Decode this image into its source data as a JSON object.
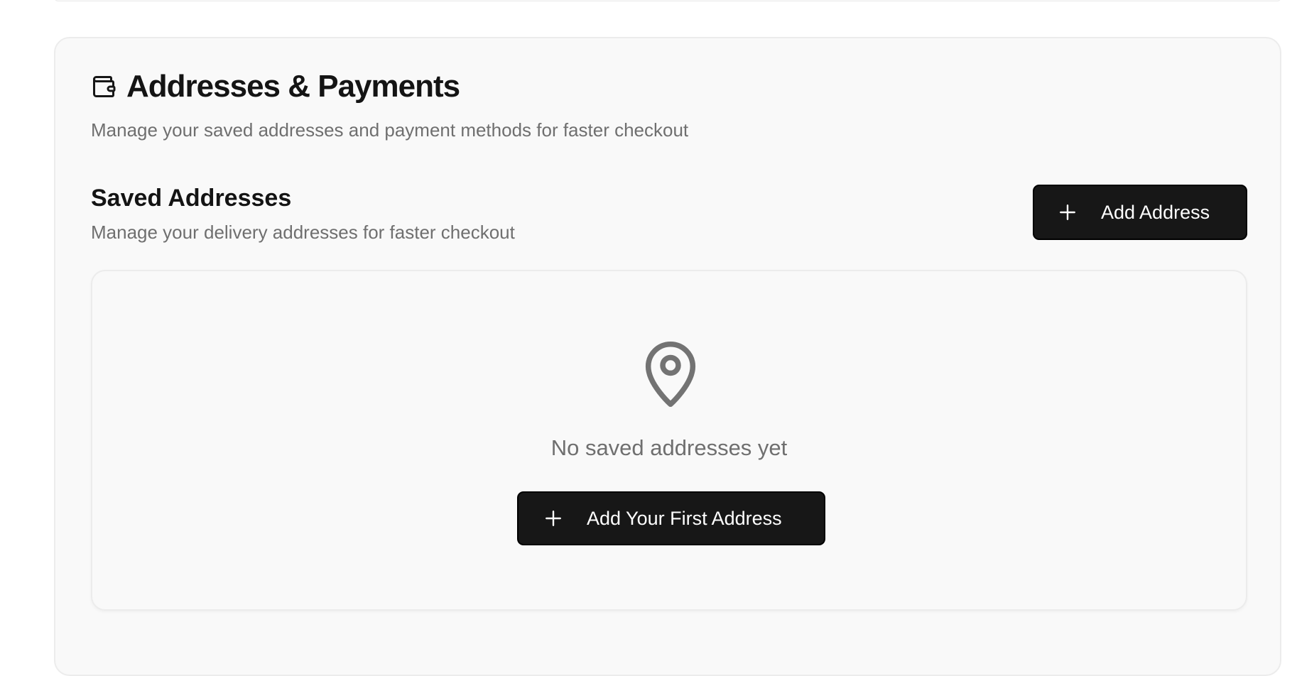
{
  "section": {
    "title": "Addresses & Payments",
    "subtitle": "Manage your saved addresses and payment methods for faster checkout",
    "icon": "wallet-icon"
  },
  "saved_addresses": {
    "title": "Saved Addresses",
    "subtitle": "Manage your delivery addresses for faster checkout",
    "add_button_label": "Add Address",
    "add_button_icon": "plus-icon"
  },
  "empty_state": {
    "icon": "map-pin-icon",
    "message": "No saved addresses yet",
    "cta_label": "Add Your First Address",
    "cta_icon": "plus-icon"
  },
  "colors": {
    "button_bg": "#171717",
    "button_text": "#ffffff",
    "muted_text": "#6f6f6f",
    "card_bg": "#f9f9f9"
  }
}
